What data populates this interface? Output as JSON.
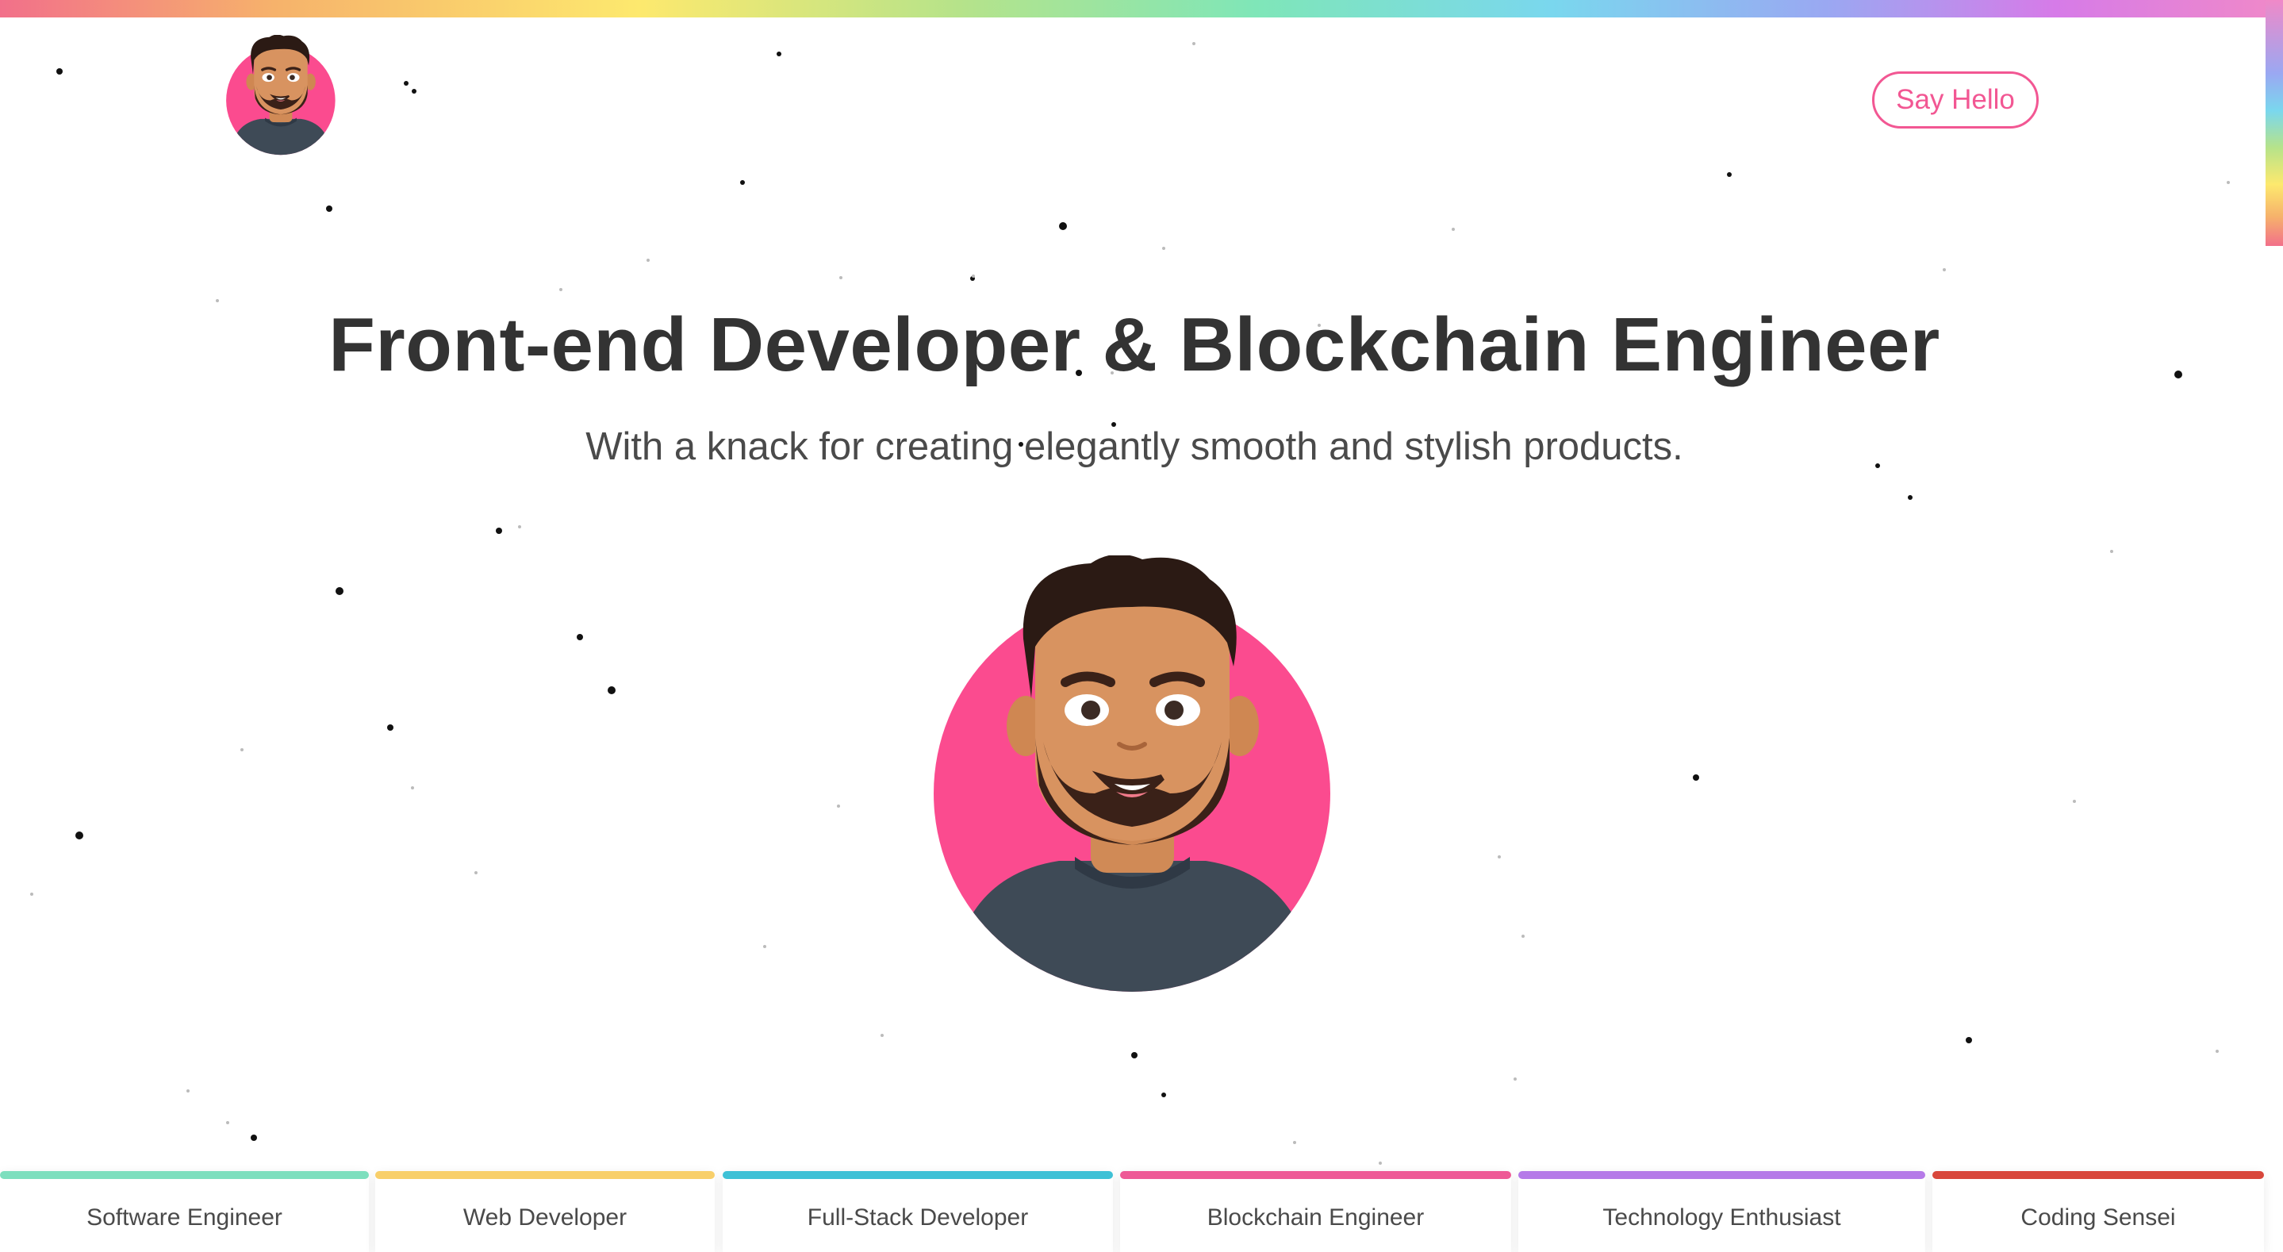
{
  "header": {
    "logo_icon": "avatar-illustration",
    "cta_label": "Say Hello"
  },
  "hero": {
    "title": "Front-end Developer & Blockchain Engineer",
    "subtitle": "With a knack for creating elegantly smooth and stylish products.",
    "avatar_icon": "avatar-illustration"
  },
  "roles": [
    {
      "label": "Software Engineer",
      "color": "#7ddfbe"
    },
    {
      "label": "Web Developer",
      "color": "#f8cf6a"
    },
    {
      "label": "Full-Stack Developer",
      "color": "#3ec1d6"
    },
    {
      "label": "Blockchain Engineer",
      "color": "#ee5a96"
    },
    {
      "label": "Technology Enthusiast",
      "color": "#b57ae8"
    },
    {
      "label": "Coding Sensei",
      "color": "#d8473b"
    }
  ],
  "colors": {
    "accent": "#f25793",
    "avatar_bg": "#fb4b8f",
    "text": "#333333"
  }
}
